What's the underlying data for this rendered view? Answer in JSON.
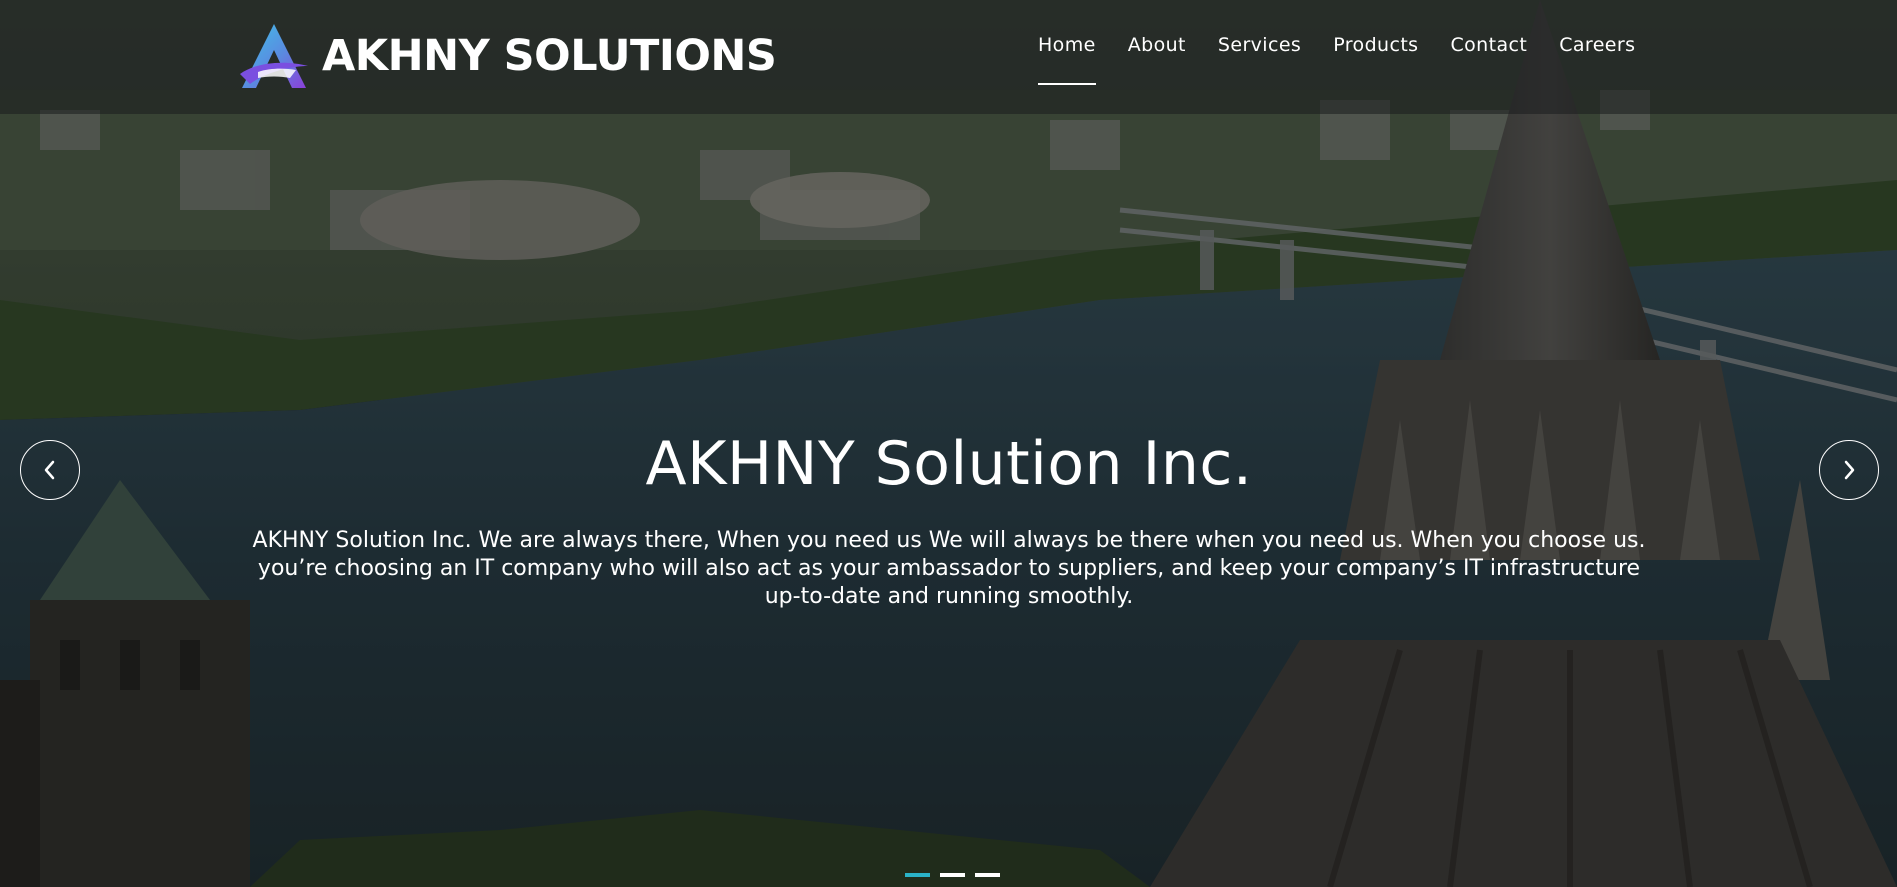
{
  "brand": {
    "name": "AKHNY SOLUTIONS",
    "logo_icon": "stylized-letter-a-logo-icon"
  },
  "nav": {
    "items": [
      {
        "label": "Home",
        "active": true
      },
      {
        "label": "About",
        "active": false
      },
      {
        "label": "Services",
        "active": false
      },
      {
        "label": "Products",
        "active": false
      },
      {
        "label": "Contact",
        "active": false
      },
      {
        "label": "Careers",
        "active": false
      }
    ]
  },
  "hero": {
    "title": "AKHNY Solution Inc.",
    "text": "AKHNY Solution Inc. We are always there, When you need us We will always be there when you need us. When you choose us. you’re choosing an IT company who will also act as your ambassador to suppliers, and keep your company’s IT infrastructure up-to-date and running smoothly.",
    "background_description_icon": "city-river-aerial-photo-icon"
  },
  "carousel": {
    "prev_icon": "chevron-left-icon",
    "next_icon": "chevron-right-icon",
    "slide_count": 3,
    "active_slide": 1
  },
  "colors": {
    "accent": "#2ab3c8",
    "header_overlay": "#191b1d",
    "text": "#ffffff",
    "logo_gradient_start": "#3fc4e8",
    "logo_gradient_end": "#8b3fd9"
  }
}
